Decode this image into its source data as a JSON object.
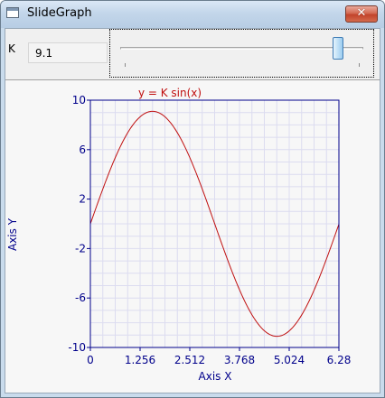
{
  "window": {
    "title": "SlideGraph",
    "close_glyph": "✕",
    "icon": "app-window-icon"
  },
  "controls": {
    "k_label": "K",
    "k_value": "9.1",
    "slider": {
      "value": 9.1,
      "min": 0,
      "max": 10
    }
  },
  "chart_data": {
    "type": "line",
    "title": "y = K sin(x)",
    "xlabel": "Axis X",
    "ylabel": "Axis Y",
    "xlim": [
      0,
      6.28
    ],
    "ylim": [
      -10,
      10
    ],
    "x_ticks": [
      "0",
      "1.256",
      "2.512",
      "3.768",
      "5.024",
      "6.28"
    ],
    "y_ticks": [
      "10",
      "6",
      "2",
      "-2",
      "-6",
      "-10"
    ],
    "grid": true,
    "series": [
      {
        "function": "K*sin(x)",
        "K": 9.1,
        "color": "#c01010"
      }
    ],
    "colors": {
      "axis": "#00008b",
      "title": "#c01010",
      "grid": "#dcdcf0"
    }
  }
}
